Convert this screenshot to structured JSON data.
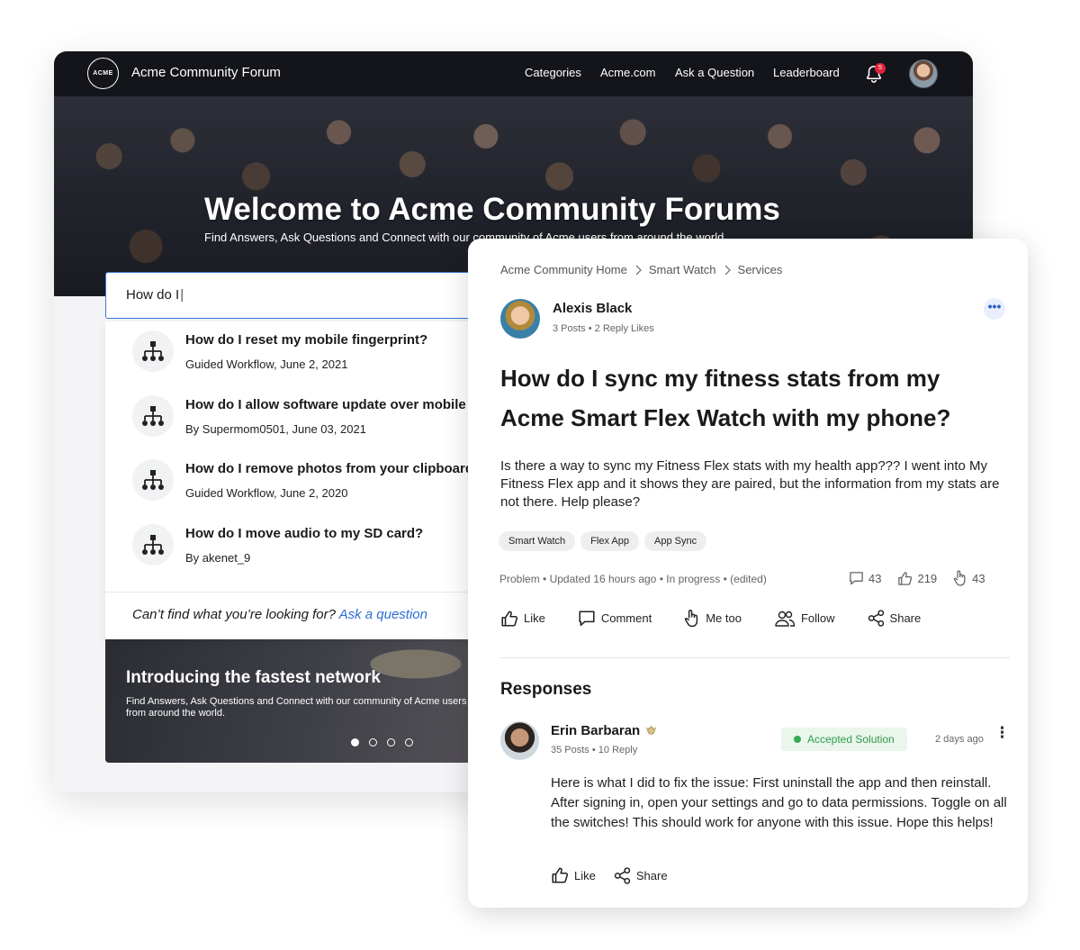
{
  "nav": {
    "logo_text": "ACME",
    "site_title": "Acme Community Forum",
    "links": [
      "Categories",
      "Acme.com",
      "Ask a Question",
      "Leaderboard"
    ],
    "notification_count": "5"
  },
  "hero": {
    "title": "Welcome to Acme Community Forums",
    "subtitle": "Find Answers, Ask Questions and Connect with our community of Acme users from around the world"
  },
  "search": {
    "value": "How do I"
  },
  "results": [
    {
      "title": "How do I reset my mobile fingerprint?",
      "meta": "Guided Workflow, June 2, 2021",
      "icon": "workflow-icon"
    },
    {
      "title": "How do I allow software update over mobile",
      "meta": "By Supermom0501, June 03, 2021",
      "icon": "workflow-icon"
    },
    {
      "title": "How do I remove photos from your clipboard",
      "meta": "Guided Workflow, June 2, 2020",
      "icon": "workflow-icon"
    },
    {
      "title": "How do I move audio to my SD card?",
      "meta": "By akenet_9",
      "icon": "workflow-icon"
    }
  ],
  "dropdown_footer": {
    "prompt": "Can’t find what you’re looking for?",
    "link": "Ask a question"
  },
  "banner": {
    "title": "Introducing the fastest network",
    "text": "Find Answers, Ask Questions and Connect with our community of Acme users from around the world.",
    "slide_count": 4,
    "active_slide": 1
  },
  "post": {
    "breadcrumbs": [
      "Acme Community Home",
      "Smart Watch",
      "Services"
    ],
    "author": {
      "name": "Alexis Black",
      "posts": "3 Posts",
      "likes": "2 Reply Likes"
    },
    "more_label": "•••",
    "title": "How do I sync my fitness stats from my Acme Smart Flex Watch with my phone?",
    "body": "Is there a way to sync my Fitness Flex stats with my health app??? I went into My Fitness Flex app and it shows they are paired, but the information from my stats are not there. Help please?",
    "tags": [
      "Smart Watch",
      "Flex App",
      "App Sync"
    ],
    "status": {
      "type": "Problem",
      "updated": "Updated 16 hours ago",
      "state": "In progress",
      "edited": "(edited)"
    },
    "counts": {
      "comments": "43",
      "likes": "219",
      "me_too": "43"
    },
    "actions": [
      "Like",
      "Comment",
      "Me too",
      "Follow",
      "Share"
    ]
  },
  "responses": {
    "heading": "Responses",
    "items": [
      {
        "name": "Erin Barbaran",
        "posts": "35 Posts",
        "replies": "10 Reply",
        "accepted_label": "Accepted Solution",
        "time": "2 days ago",
        "body": "Here is what I did to fix the issue: First uninstall the app and then reinstall. After signing in, open your settings and go to data permissions.  Toggle on all the switches! This should work for anyone with this issue. Hope this helps!",
        "actions": [
          "Like",
          "Share"
        ]
      }
    ]
  },
  "colors": {
    "nav_bg": "#14151a",
    "link_blue": "#2e6fd6",
    "accepted_green": "#2f9c4a",
    "badge_red": "#e0243a"
  }
}
